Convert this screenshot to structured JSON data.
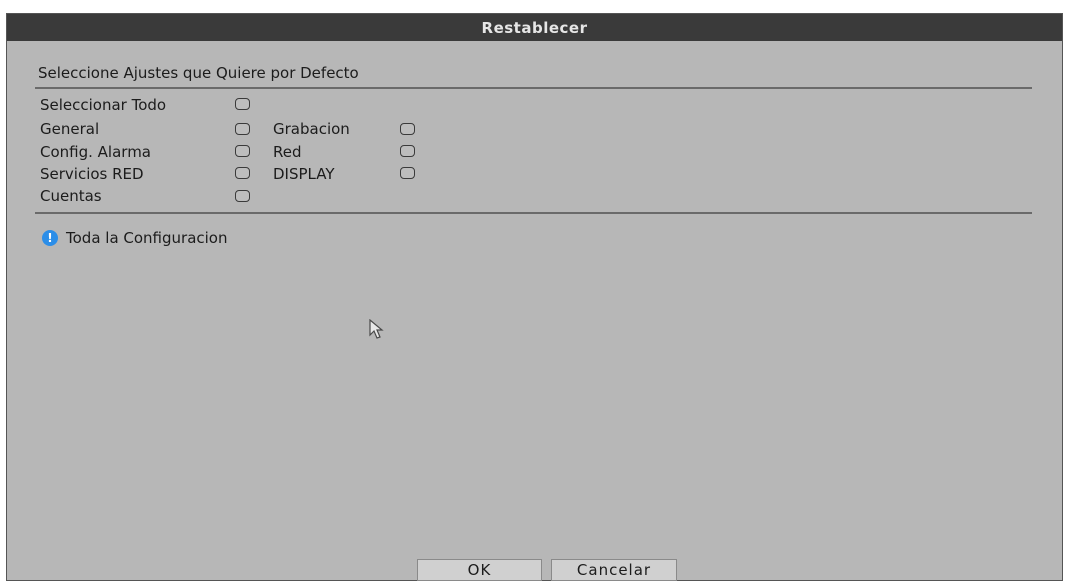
{
  "dialog": {
    "title": "Restablecer",
    "heading": "Seleccione Ajustes que Quiere por Defecto",
    "options": {
      "select_all": "Seleccionar Todo",
      "general": "General",
      "grabacion": "Grabacion",
      "config_alarma": "Config. Alarma",
      "red": "Red",
      "servicios_red": "Servicios RED",
      "display": "DISPLAY",
      "cuentas": "Cuentas"
    },
    "info_text": "Toda la Configuracion",
    "info_icon": "info-icon",
    "buttons": {
      "ok": "OK",
      "cancel": "Cancelar"
    }
  },
  "colors": {
    "titlebar": "#3a3a3a",
    "background": "#b7b7b7",
    "info_accent": "#2c8ee8"
  }
}
